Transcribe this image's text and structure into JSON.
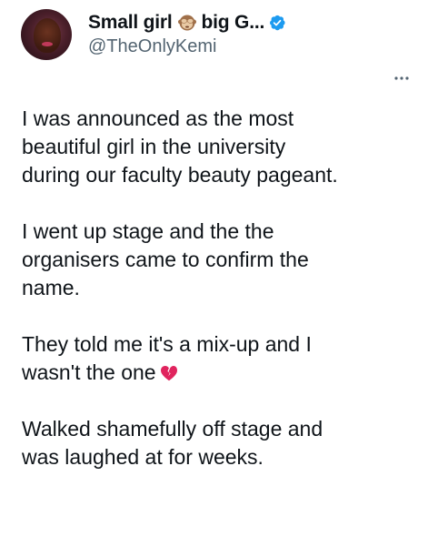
{
  "tweet": {
    "display_name_part1": "Small girl",
    "display_name_part2": "big G...",
    "name_emoji": "see-no-evil-monkey-icon",
    "verified": true,
    "handle": "@TheOnlyKemi",
    "paragraphs": [
      {
        "lines": [
          "I was announced as the most",
          "beautiful girl in the university",
          "during  our faculty beauty pageant."
        ]
      },
      {
        "lines": [
          "I went up stage and the the",
          "organisers came to confirm the",
          "name."
        ]
      },
      {
        "lines": [
          "They told me it's a mix-up and I",
          "wasn't the one"
        ],
        "trailing_emoji": "broken-heart-icon"
      },
      {
        "lines": [
          "Walked shamefully off stage and",
          "was laughed at for weeks."
        ]
      }
    ]
  },
  "colors": {
    "text": "#0f1419",
    "secondary_text": "#536471",
    "verified_badge": "#1d9bf0",
    "broken_heart": "#e0245e",
    "background": "#ffffff"
  }
}
